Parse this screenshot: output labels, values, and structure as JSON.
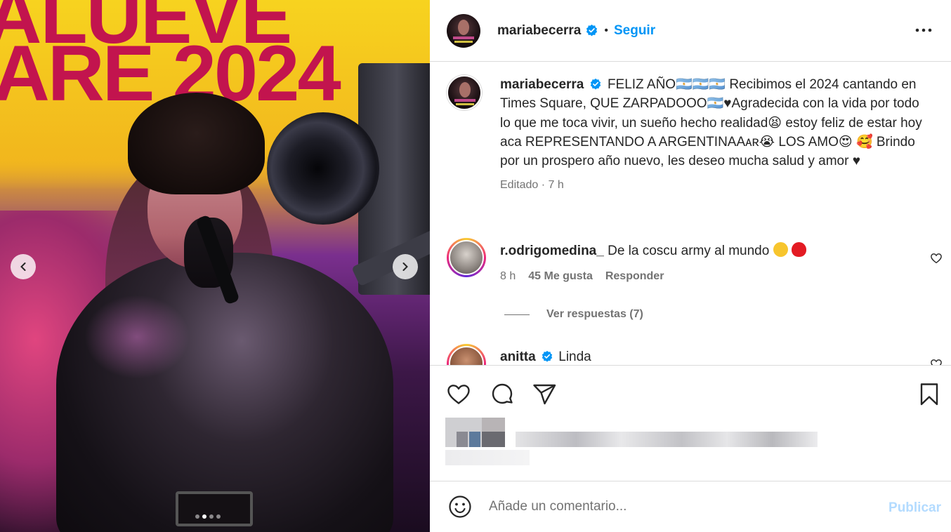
{
  "media": {
    "banner_line1": "ALUEVE",
    "banner_line2": "ARE 2024",
    "carousel_index": 2,
    "carousel_count": 4
  },
  "header": {
    "username": "mariabecerra",
    "separator": "•",
    "follow_label": "Seguir"
  },
  "caption": {
    "username": "mariabecerra",
    "text": "FELIZ AÑO🇦🇷🇦🇷🇦🇷 Recibimos el 2024 cantando en Times Square, QUE ZARPADOOO🇦🇷♥Agradecida con la vida por todo lo que me toca vivir, un sueño hecho realidad😫 estoy feliz de estar hoy aca REPRESENTANDO A ARGENTINAAᴀʀ😭 LOS AMO😍 🥰 Brindo por un prospero año nuevo, les deseo mucha salud y amor ♥",
    "meta": "Editado · 7 h"
  },
  "comments": [
    {
      "username": "r.odrigomedina_",
      "text": "De la coscu army al mundo",
      "time": "8 h",
      "likes": "45 Me gusta",
      "reply_label": "Responder",
      "view_replies": "Ver respuestas (7)"
    },
    {
      "username": "anitta",
      "text": "Linda"
    }
  ],
  "composer": {
    "placeholder": "Añade un comentario...",
    "publish_label": "Publicar"
  },
  "icons": {
    "heart": "heart-icon",
    "comment": "comment-icon",
    "share": "share-icon",
    "save": "bookmark-icon",
    "emoji": "emoji-icon",
    "more": "more-options-icon"
  },
  "colors": {
    "accent": "#0095f6",
    "publish_disabled": "#b3dbff",
    "text": "#262626",
    "muted": "#737373",
    "border": "#dbdbdb"
  }
}
